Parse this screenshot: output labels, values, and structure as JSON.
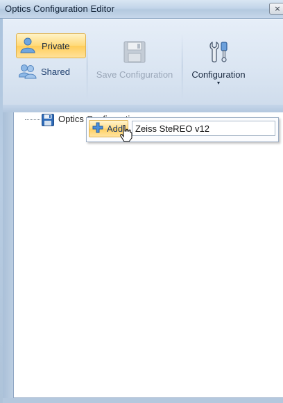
{
  "window": {
    "title": "Optics Configuration Editor",
    "close_glyph": "×"
  },
  "ribbon": {
    "private_label": "Private",
    "shared_label": "Shared",
    "save_label": "Save Configuration",
    "config_label": "Configuration",
    "config_caret": "▾"
  },
  "tree": {
    "root_label": "Optics Configuration"
  },
  "popup": {
    "add_label": "Add",
    "name_value": "Zeiss SteREO v12"
  },
  "icons": {
    "private": "users-icon",
    "shared": "users-icon",
    "save": "floppy-disk-icon",
    "config": "wrench-screwdriver-icon",
    "tree_root": "floppy-disk-icon",
    "add": "plus-icon"
  },
  "colors": {
    "selected_button": "#ffd978",
    "ribbon_bg": "#dae5f2",
    "frame": "#b9cde3"
  }
}
